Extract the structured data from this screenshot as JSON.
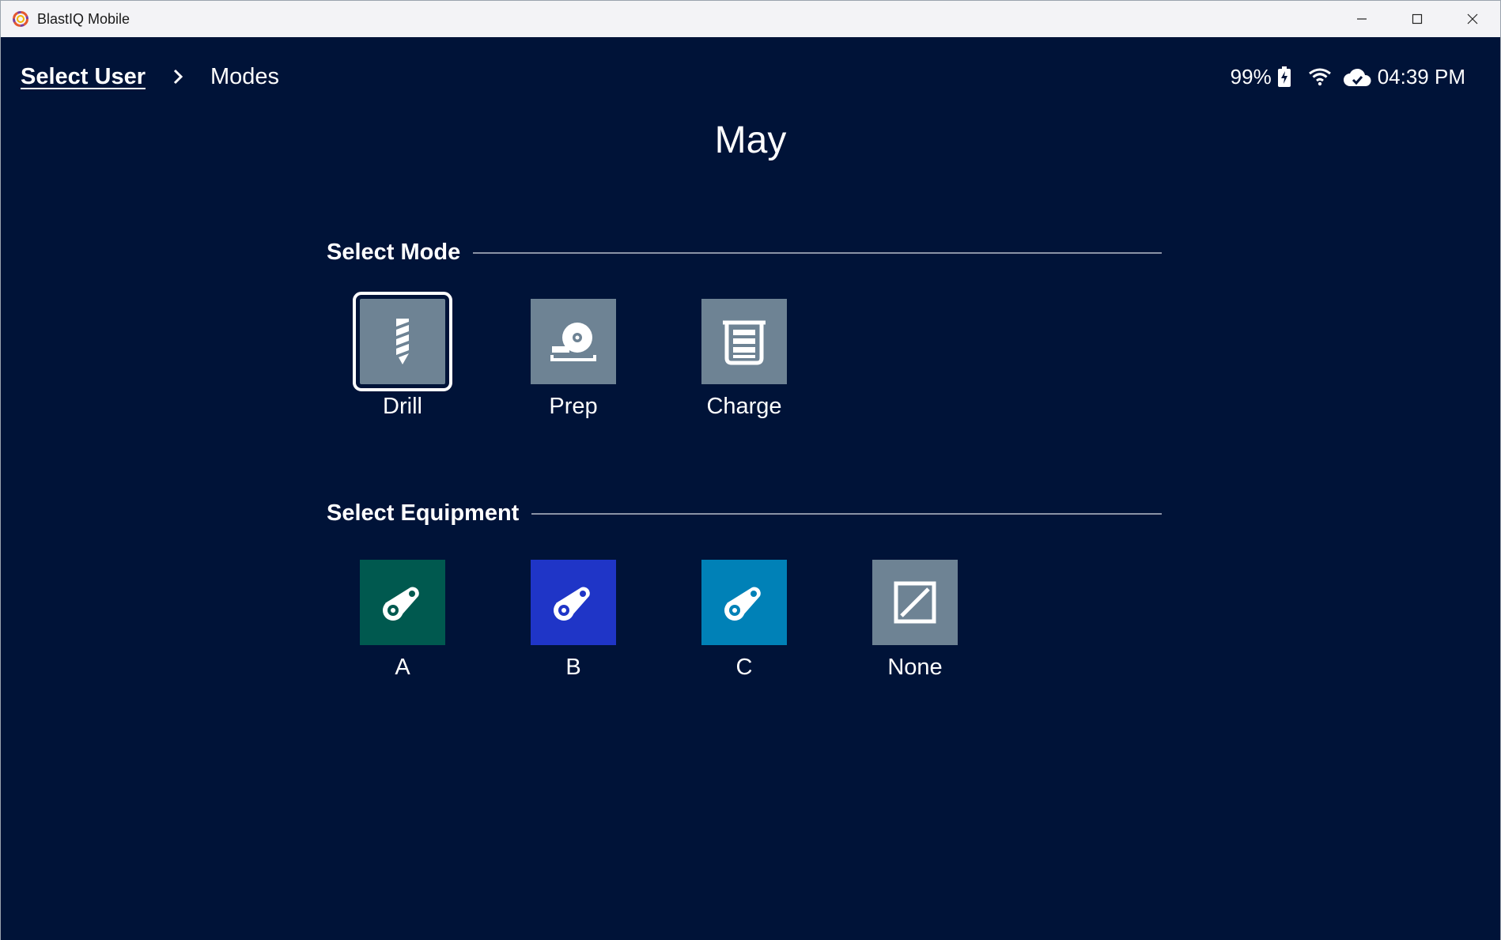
{
  "window": {
    "title": "BlastIQ Mobile",
    "controls": [
      "minimize-icon",
      "maximize-icon",
      "close-icon"
    ]
  },
  "breadcrumb": {
    "link_label": "Select User",
    "current_label": "Modes"
  },
  "status": {
    "battery": "99%",
    "time": "04:39 PM",
    "icons": [
      "battery-charging-icon",
      "wifi-icon",
      "cloud-icon"
    ]
  },
  "user_name": "May",
  "modes": {
    "heading": "Select Mode",
    "items": [
      {
        "label": "Drill",
        "icon": "drill-icon",
        "selected": true,
        "color": "#6e8394"
      },
      {
        "label": "Prep",
        "icon": "prep-icon",
        "selected": false,
        "color": "#6e8394"
      },
      {
        "label": "Charge",
        "icon": "charge-icon",
        "selected": false,
        "color": "#6e8394"
      }
    ]
  },
  "equipment": {
    "heading": "Select Equipment",
    "items": [
      {
        "label": "A",
        "icon": "equipment-icon",
        "color": "#00594f"
      },
      {
        "label": "B",
        "icon": "equipment-icon",
        "color": "#1f35c7"
      },
      {
        "label": "C",
        "icon": "equipment-icon",
        "color": "#0081b7"
      },
      {
        "label": "None",
        "icon": "none-icon",
        "color": "#6e8394"
      }
    ]
  },
  "colors": {
    "background": "#001338",
    "titlebar": "#f3f3f6",
    "text": "#ffffff"
  }
}
